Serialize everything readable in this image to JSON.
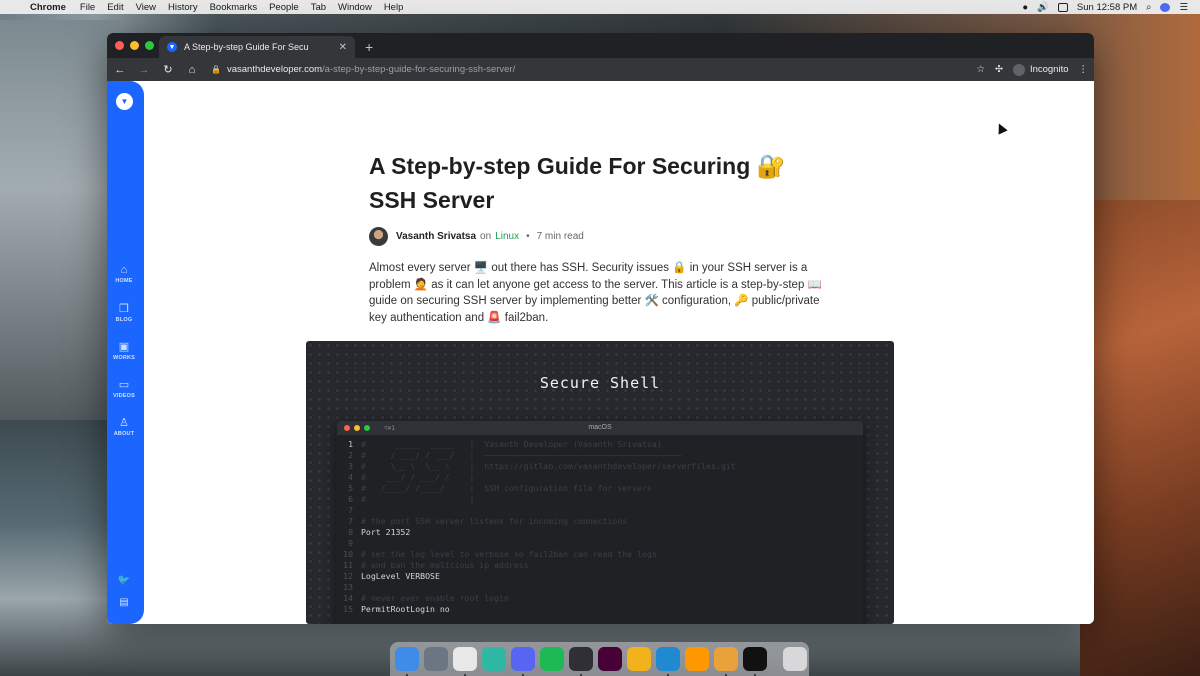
{
  "menubar": {
    "app_name": "Chrome",
    "items": [
      "File",
      "Edit",
      "View",
      "History",
      "Bookmarks",
      "People",
      "Tab",
      "Window",
      "Help"
    ],
    "clock": "Sun 12:58 PM"
  },
  "browser": {
    "tab_title": "A Step-by-step Guide For Secu",
    "url_host": "vasanthdeveloper.com",
    "url_path": "/a-step-by-step-guide-for-securing-ssh-server/",
    "incognito_label": "Incognito"
  },
  "sidebar": {
    "items": [
      {
        "label": "HOME",
        "icon": "home-icon"
      },
      {
        "label": "BLOG",
        "icon": "blog-icon"
      },
      {
        "label": "WORKS",
        "icon": "briefcase-icon"
      },
      {
        "label": "VIDEOS",
        "icon": "video-icon"
      },
      {
        "label": "ABOUT",
        "icon": "user-icon"
      }
    ]
  },
  "article": {
    "title_line1": "A Step-by-step Guide For Securing 🔐",
    "title_line2": "SSH Server",
    "author": "Vasanth Srivatsa",
    "on": "on",
    "category": "Linux",
    "bullet": "•",
    "read_time": "7 min read",
    "intro": "Almost every server 🖥️ out there has SSH. Security issues 🔒 in your SSH server is a problem 🤦 as it can let anyone get access to the server. This article is a step-by-step 📖 guide on securing SSH server by implementing better 🛠️ configuration, 🔑 public/private key authentication and 🚨 fail2ban."
  },
  "hero": {
    "title": "Secure Shell",
    "terminal_title": "macOS",
    "terminal_shortcut": "⌥⌘1",
    "lines": [
      {
        "n": "1",
        "t": "#      _____  _____   |  Vasanth Developer (Vasanth Srivatsa)",
        "lit": "first"
      },
      {
        "n": "2",
        "t": "#     / ___/ / ___/   |  ————————————————————————————————————————",
        "lit": ""
      },
      {
        "n": "3",
        "t": "#     \\__ \\  \\__ \\    |  https://gitlab.com/vasanthdeveloper/serverfiles.git",
        "lit": ""
      },
      {
        "n": "4",
        "t": "#    ___/ / ___/ /    |",
        "lit": ""
      },
      {
        "n": "5",
        "t": "#   /____/ /____/     |  SSH configuration file for servers",
        "lit": ""
      },
      {
        "n": "6",
        "t": "#                     |",
        "lit": ""
      },
      {
        "n": "7",
        "t": "",
        "lit": ""
      },
      {
        "n": "7",
        "t": "# the port SSH server listens for incoming connections",
        "lit": ""
      },
      {
        "n": "8",
        "t": "Port 21352",
        "lit": "yes"
      },
      {
        "n": "9",
        "t": "",
        "lit": ""
      },
      {
        "n": "10",
        "t": "# set the log level to verbose so fail2ban can read the logs",
        "lit": ""
      },
      {
        "n": "11",
        "t": "# and ban the malicious ip address",
        "lit": ""
      },
      {
        "n": "12",
        "t": "LogLevel VERBOSE",
        "lit": "yes"
      },
      {
        "n": "13",
        "t": "",
        "lit": ""
      },
      {
        "n": "14",
        "t": "# never ever enable root login",
        "lit": ""
      },
      {
        "n": "15",
        "t": "PermitRootLogin no",
        "lit": "yes"
      }
    ]
  },
  "dock": {
    "apps": [
      {
        "name": "finder",
        "color": "#3d8de8"
      },
      {
        "name": "launchpad",
        "color": "#6c7683"
      },
      {
        "name": "chrome",
        "color": "#e8e8e8"
      },
      {
        "name": "mail",
        "color": "#2fb8a4"
      },
      {
        "name": "discord",
        "color": "#5865f2"
      },
      {
        "name": "spotify",
        "color": "#1db954"
      },
      {
        "name": "obs",
        "color": "#302f36"
      },
      {
        "name": "adobe-xd",
        "color": "#470137"
      },
      {
        "name": "vector-app",
        "color": "#f2b21b"
      },
      {
        "name": "vscode",
        "color": "#1f8ad2"
      },
      {
        "name": "sublime-text",
        "color": "#ff9800"
      },
      {
        "name": "cyberduck",
        "color": "#e9a23b"
      },
      {
        "name": "terminal",
        "color": "#111111"
      },
      {
        "name": "trash",
        "color": "#d8d8da"
      }
    ]
  }
}
